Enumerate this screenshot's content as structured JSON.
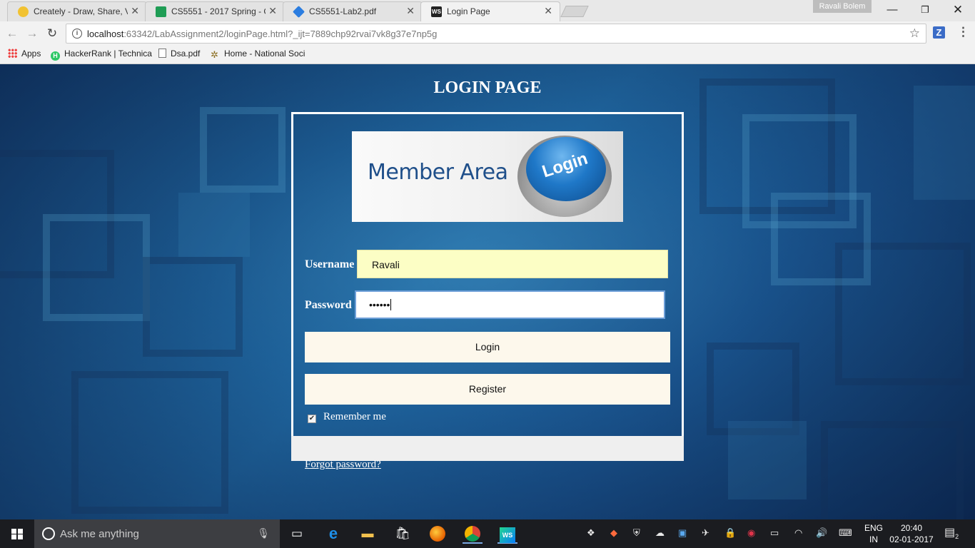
{
  "browser": {
    "tabs": [
      {
        "title": "Creately - Draw, Share, V",
        "favicon_color": "#f1c232"
      },
      {
        "title": "CS5551 - 2017 Spring - G",
        "favicon_color": "#1f9d55"
      },
      {
        "title": "CS5551-Lab2.pdf",
        "favicon_color": "#2b7de0"
      },
      {
        "title": "Login Page",
        "favicon_color": "#222222"
      }
    ],
    "profile_name": "Ravali Bolem",
    "url_host": "localhost",
    "url_rest": ":63342/LabAssignment2/loginPage.html?_ijt=7889chp92rvai7vk8g37e7np5g",
    "extension_label": "Z",
    "bookmarks": [
      {
        "label": "Apps",
        "icon": "apps-grid-icon"
      },
      {
        "label": "HackerRank | Technica",
        "icon": "hackerrank-icon"
      },
      {
        "label": "Dsa.pdf",
        "icon": "document-icon"
      },
      {
        "label": "Home - National Soci",
        "icon": "national-society-icon"
      }
    ]
  },
  "page": {
    "title": "LOGIN PAGE",
    "banner": {
      "text": "Member Area",
      "button_text": "Login"
    },
    "username": {
      "label": "Username",
      "value": "Ravali"
    },
    "password": {
      "label": "Password",
      "value": "••••••"
    },
    "login_button": "Login",
    "register_button": "Register",
    "remember_label": "Remember me",
    "remember_checked": true,
    "forgot_link": "Forgot password?"
  },
  "taskbar": {
    "search_placeholder": "Ask me anything",
    "language_line1": "ENG",
    "language_line2": "IN",
    "time": "20:40",
    "date": "02-01-2017",
    "notification_count": "2"
  }
}
